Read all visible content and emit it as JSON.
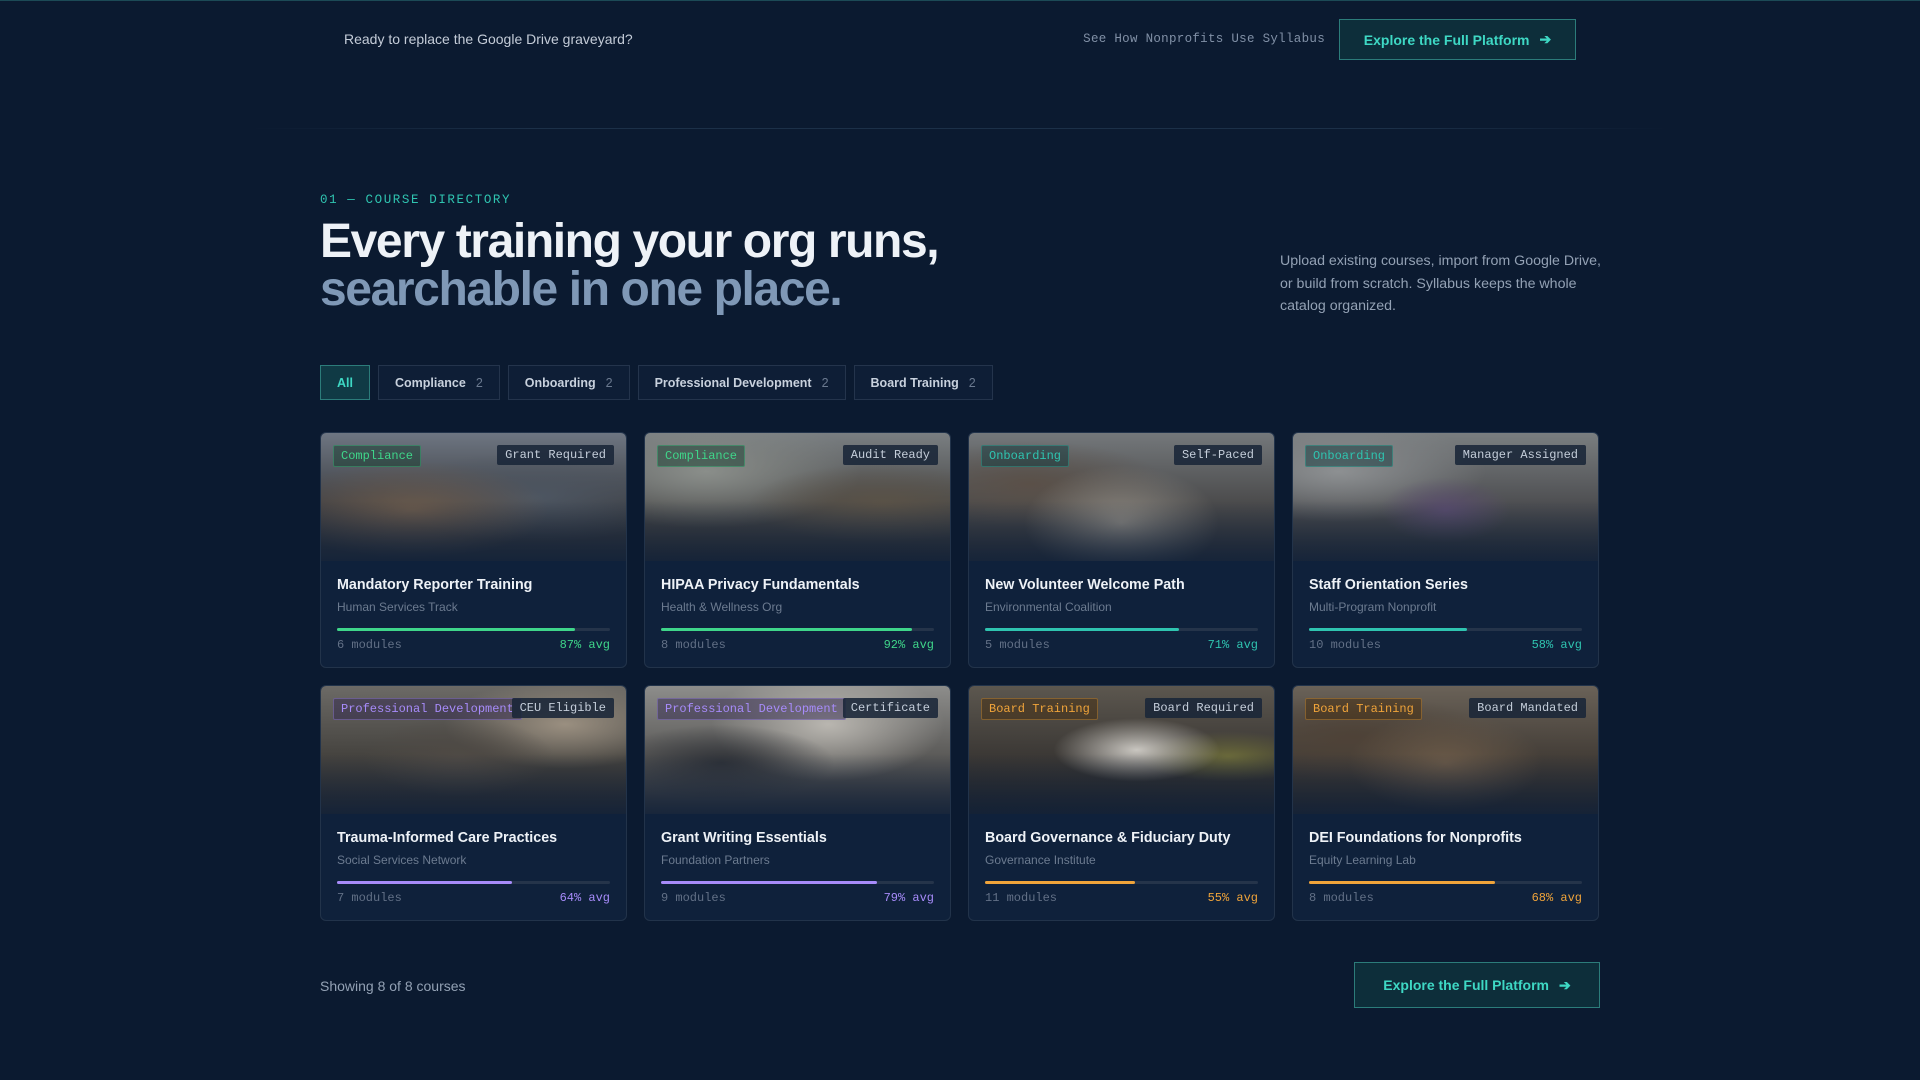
{
  "topbar": {
    "lead_text": "Ready to replace the Google Drive graveyard?",
    "see_how_link": "See How Nonprofits Use Syllabus",
    "cta_label": "Explore the Full Platform"
  },
  "section": {
    "eyebrow": "01 — COURSE DIRECTORY",
    "headline_line1": "Every training your org runs,",
    "headline_line2": "searchable in one place.",
    "intro": "Upload existing courses, import from Google Drive, or build from scratch. Syllabus keeps the whole catalog organized."
  },
  "filters": [
    {
      "label": "All",
      "count": "",
      "active": true
    },
    {
      "label": "Compliance",
      "count": "2",
      "active": false
    },
    {
      "label": "Onboarding",
      "count": "2",
      "active": false
    },
    {
      "label": "Professional Development",
      "count": "2",
      "active": false
    },
    {
      "label": "Board Training",
      "count": "2",
      "active": false
    }
  ],
  "colors": {
    "compliance": "#3fd68a",
    "onboarding": "#2fc4b0",
    "professional_development": "#a78bfa",
    "board_training": "#f0a43a"
  },
  "courses": [
    {
      "category": "Compliance",
      "badge": "Grant Required",
      "title": "Mandatory Reporter Training",
      "org": "Human Services Track",
      "modules": "6 modules",
      "avg": "87% avg",
      "progress": 0.87,
      "color": "#3fd68a"
    },
    {
      "category": "Compliance",
      "badge": "Audit Ready",
      "title": "HIPAA Privacy Fundamentals",
      "org": "Health & Wellness Org",
      "modules": "8 modules",
      "avg": "92% avg",
      "progress": 0.92,
      "color": "#3fd68a"
    },
    {
      "category": "Onboarding",
      "badge": "Self-Paced",
      "title": "New Volunteer Welcome Path",
      "org": "Environmental Coalition",
      "modules": "5 modules",
      "avg": "71% avg",
      "progress": 0.71,
      "color": "#2fc4b0"
    },
    {
      "category": "Onboarding",
      "badge": "Manager Assigned",
      "title": "Staff Orientation Series",
      "org": "Multi-Program Nonprofit",
      "modules": "10 modules",
      "avg": "58% avg",
      "progress": 0.58,
      "color": "#2fc4b0"
    },
    {
      "category": "Professional Development",
      "badge": "CEU Eligible",
      "title": "Trauma-Informed Care Practices",
      "org": "Social Services Network",
      "modules": "7 modules",
      "avg": "64% avg",
      "progress": 0.64,
      "color": "#a78bfa"
    },
    {
      "category": "Professional Development",
      "badge": "Certificate",
      "title": "Grant Writing Essentials",
      "org": "Foundation Partners",
      "modules": "9 modules",
      "avg": "79% avg",
      "progress": 0.79,
      "color": "#a78bfa"
    },
    {
      "category": "Board Training",
      "badge": "Board Required",
      "title": "Board Governance & Fiduciary Duty",
      "org": "Governance Institute",
      "modules": "11 modules",
      "avg": "55% avg",
      "progress": 0.55,
      "color": "#f0a43a"
    },
    {
      "category": "Board Training",
      "badge": "Board Mandated",
      "title": "DEI Foundations for Nonprofits",
      "org": "Equity Learning Lab",
      "modules": "8 modules",
      "avg": "68% avg",
      "progress": 0.68,
      "color": "#f0a43a"
    }
  ],
  "footer": {
    "showing": "Showing 8 of 8 courses",
    "cta_label": "Explore the Full Platform"
  }
}
